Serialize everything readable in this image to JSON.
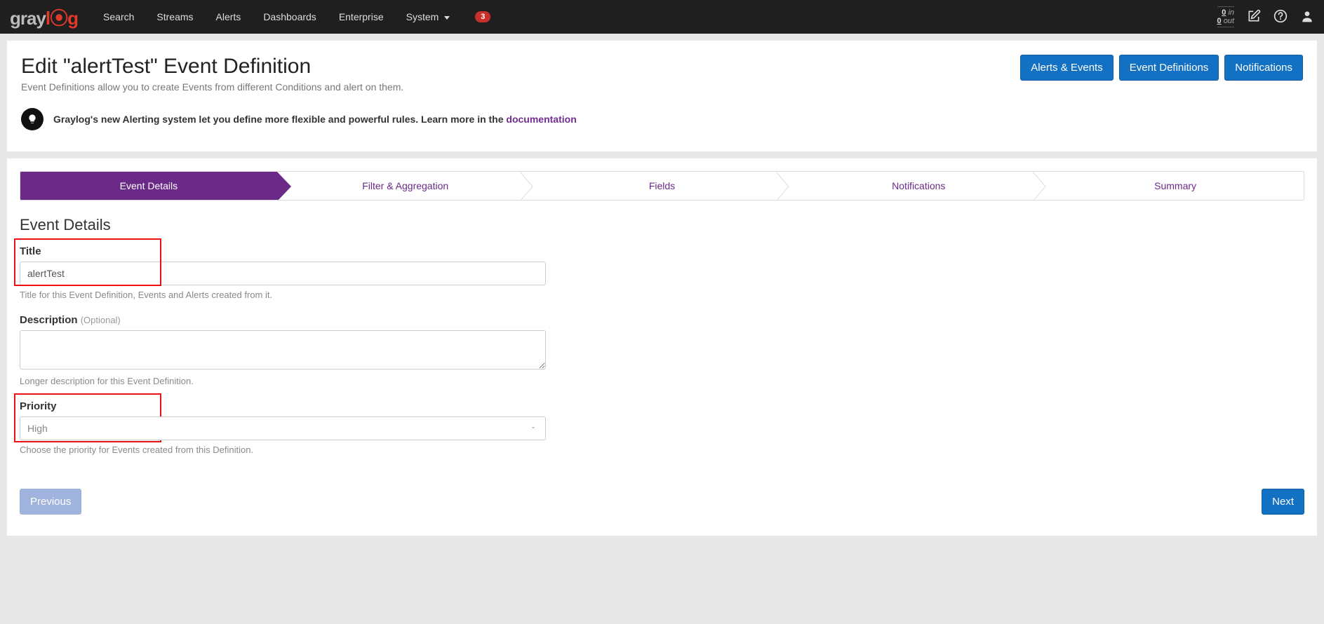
{
  "nav": {
    "items": [
      "Search",
      "Streams",
      "Alerts",
      "Dashboards",
      "Enterprise",
      "System"
    ],
    "badge": "3",
    "throughput_in_value": "0",
    "throughput_in_label": "in",
    "throughput_out_value": "0",
    "throughput_out_label": "out"
  },
  "header": {
    "title": "Edit \"alertTest\" Event Definition",
    "subtitle": "Event Definitions allow you to create Events from different Conditions and alert on them.",
    "buttons": [
      "Alerts & Events",
      "Event Definitions",
      "Notifications"
    ],
    "tip_prefix": "Graylog's new Alerting system let you define more flexible and powerful rules. Learn more in the ",
    "tip_link": "documentation"
  },
  "wizard": {
    "steps": [
      "Event Details",
      "Filter & Aggregation",
      "Fields",
      "Notifications",
      "Summary"
    ],
    "active_index": 0
  },
  "form": {
    "section_heading": "Event Details",
    "title_label": "Title",
    "title_value": "alertTest",
    "title_help": "Title for this Event Definition, Events and Alerts created from it.",
    "description_label": "Description",
    "description_optional": "(Optional)",
    "description_value": "",
    "description_help": "Longer description for this Event Definition.",
    "priority_label": "Priority",
    "priority_value": "High",
    "priority_help": "Choose the priority for Events created from this Definition."
  },
  "footer": {
    "previous": "Previous",
    "next": "Next"
  }
}
